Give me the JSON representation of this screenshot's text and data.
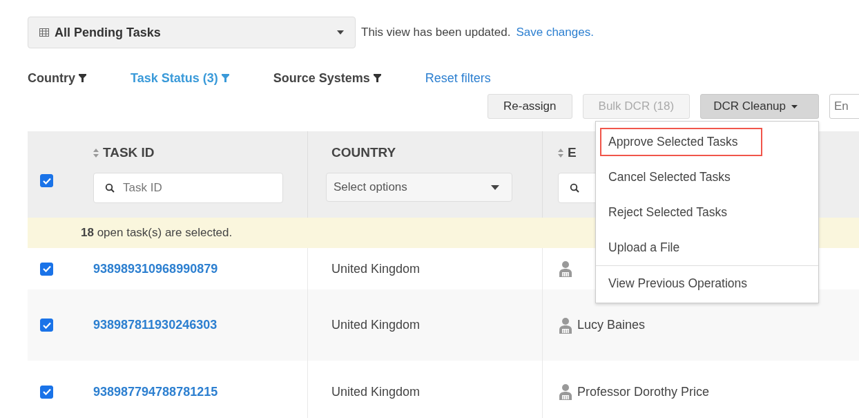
{
  "view_select": {
    "label": "All Pending Tasks"
  },
  "update_notice": {
    "text": "This view has been updated.",
    "link": "Save changes."
  },
  "filters": [
    {
      "label": "Country",
      "active": false
    },
    {
      "label": "Task Status (3)",
      "active": true
    },
    {
      "label": "Source Systems",
      "active": false
    }
  ],
  "reset_filters": "Reset filters",
  "toolbar": {
    "buttons": [
      {
        "label": "Re-assign",
        "disabled": false
      },
      {
        "label": "Bulk DCR (18)",
        "disabled": true
      }
    ],
    "dropdown": {
      "label": "DCR Cleanup",
      "expanded": true
    },
    "search": {
      "placeholder": "En"
    }
  },
  "menu": {
    "items": [
      {
        "label": "Approve Selected Tasks",
        "selected": true,
        "divider_before": false
      },
      {
        "label": "Cancel Selected Tasks",
        "selected": false,
        "divider_before": false
      },
      {
        "label": "Reject Selected Tasks",
        "selected": false,
        "divider_before": false
      },
      {
        "label": "Upload a File",
        "selected": false,
        "divider_before": false
      },
      {
        "label": "View Previous Operations",
        "selected": false,
        "divider_before": true
      }
    ]
  },
  "table": {
    "select_all": {
      "checked": true
    },
    "columns": [
      {
        "label": "TASK ID",
        "sortable": true,
        "filter": {
          "kind": "search",
          "placeholder": "Task ID"
        }
      },
      {
        "label": "COUNTRY",
        "sortable": false,
        "filter": {
          "kind": "select",
          "placeholder": "Select options"
        }
      },
      {
        "label": "E",
        "sortable": true,
        "filter": {
          "kind": "search"
        }
      }
    ],
    "banner": {
      "text": "**18** open task(s) are selected."
    },
    "rows": [
      {
        "checked": true,
        "task_id": "938989310968990879",
        "country": "United Kingdom"
      },
      {
        "checked": true,
        "task_id": "938987811930246303",
        "country": "United Kingdom",
        "assignee": "Lucy Baines"
      },
      {
        "checked": true,
        "task_id": "938987794788781215",
        "country": "United Kingdom",
        "assignee": "Professor Dorothy Price"
      }
    ]
  }
}
